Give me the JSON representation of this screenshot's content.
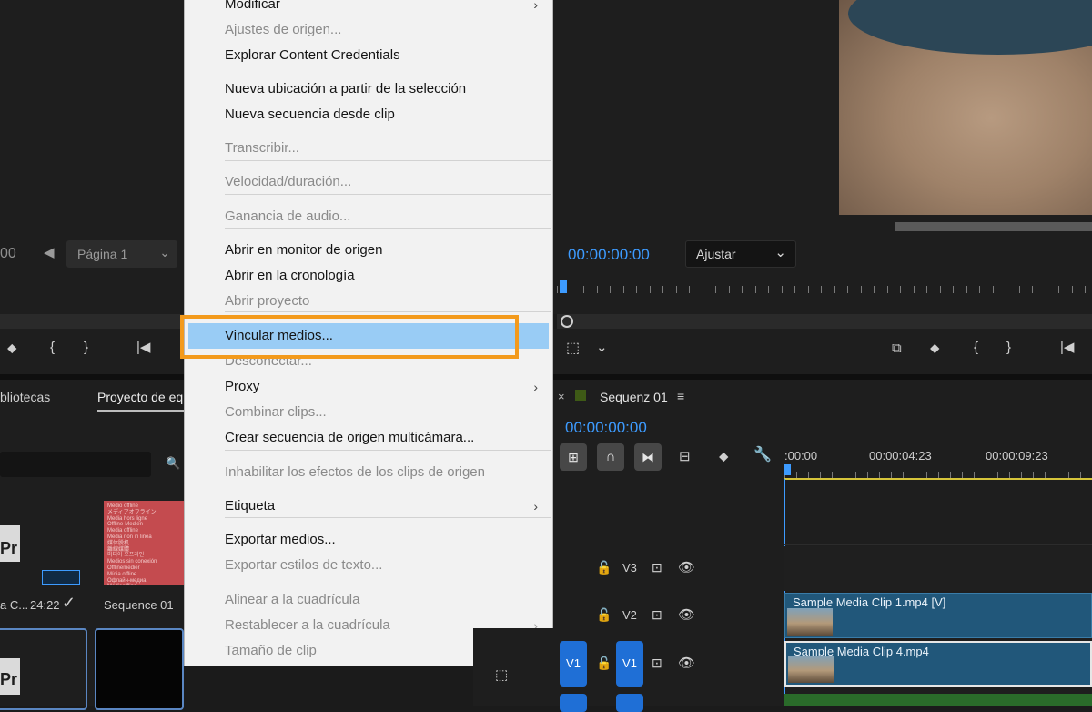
{
  "source_monitor": {
    "left_timecode_fragment": "00",
    "page_selector": "Página 1"
  },
  "program_monitor": {
    "timecode": "00:00:00:00",
    "fit_dropdown": "Ajustar"
  },
  "project_panel": {
    "tab_libraries": "bliotecas",
    "tab_project": "Proyecto de eq",
    "item1_name": "a C...",
    "item1_duration": "24:22",
    "item2_name": "Sequence 01",
    "thumb_text": "Medio offline\nメディアオフライン\nMedia hors ligne\nOffline-Medien\nMedia offline\nMedia non in linea\n媒体脱机\n離線媒體\n미디어 오프라인\nMedios sin conexión\nOfflinemedier\nMídia offline\nОфлайн-медиа\nMediaoffline\nCzynnik offline\nOffline médium\nMedya çevrimdışı"
  },
  "timeline": {
    "tab_title": "Sequenz 01",
    "timecode": "00:00:00:00",
    "ruler_labels": [
      ":00:00",
      "00:00:04:23",
      "00:00:09:23"
    ],
    "tracks": [
      {
        "name": "V3"
      },
      {
        "name": "V2"
      },
      {
        "name": "V1",
        "source": "V1"
      }
    ],
    "clips": [
      {
        "name": "Sample Media Clip 1.mp4 [V]"
      },
      {
        "name": "Sample Media Clip 4.mp4"
      }
    ]
  },
  "context_menu": {
    "items": [
      {
        "label": "Modificar",
        "disabled": false,
        "submenu": true
      },
      {
        "label": "Ajustes de origen...",
        "disabled": true,
        "submenu": false
      },
      {
        "label": "Explorar Content Credentials",
        "disabled": false,
        "submenu": false
      },
      {
        "label": "Nueva ubicación a partir de la selección",
        "disabled": false,
        "submenu": false
      },
      {
        "label": "Nueva secuencia desde clip",
        "disabled": false,
        "submenu": false
      },
      {
        "label": "Transcribir...",
        "disabled": true,
        "submenu": false
      },
      {
        "label": "Velocidad/duración...",
        "disabled": true,
        "submenu": false
      },
      {
        "label": "Ganancia de audio...",
        "disabled": true,
        "submenu": false
      },
      {
        "label": "Abrir en monitor de origen",
        "disabled": false,
        "submenu": false
      },
      {
        "label": "Abrir en la cronología",
        "disabled": false,
        "submenu": false
      },
      {
        "label": "Abrir proyecto",
        "disabled": true,
        "submenu": false
      },
      {
        "label": "Vincular medios...",
        "disabled": false,
        "submenu": false,
        "highlighted": true
      },
      {
        "label": "Desconectar...",
        "disabled": true,
        "submenu": false
      },
      {
        "label": "Proxy",
        "disabled": false,
        "submenu": true
      },
      {
        "label": "Combinar clips...",
        "disabled": true,
        "submenu": false
      },
      {
        "label": "Crear secuencia de origen multicámara...",
        "disabled": false,
        "submenu": false
      },
      {
        "label": "Inhabilitar los efectos de los clips de origen",
        "disabled": true,
        "submenu": false
      },
      {
        "label": "Etiqueta",
        "disabled": false,
        "submenu": true
      },
      {
        "label": "Exportar medios...",
        "disabled": false,
        "submenu": false
      },
      {
        "label": "Exportar estilos de texto...",
        "disabled": true,
        "submenu": false
      },
      {
        "label": "Alinear a la cuadrícula",
        "disabled": true,
        "submenu": false
      },
      {
        "label": "Restablecer a la cuadrícula",
        "disabled": true,
        "submenu": true
      },
      {
        "label": "Tamaño de clip",
        "disabled": true,
        "submenu": true
      }
    ],
    "submenu_arrow": "›"
  },
  "colors": {
    "accent_blue": "#3d9bff",
    "highlight": "#99ccf5",
    "callout": "#f39a1c",
    "clip": "#21577a",
    "track_target": "#1f6fd6"
  }
}
